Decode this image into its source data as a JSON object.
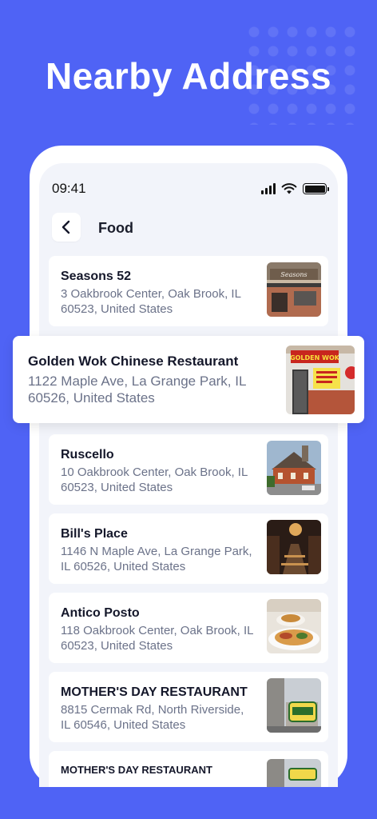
{
  "headline": "Nearby Address",
  "status": {
    "time": "09:41"
  },
  "nav": {
    "title": "Food"
  },
  "featured": {
    "name": "Golden Wok Chinese Restaurant",
    "address": "1122 Maple Ave, La Grange Park, IL 60526, United States"
  },
  "places": [
    {
      "name": "Seasons 52",
      "address": "3 Oakbrook Center, Oak Brook, IL 60523, United States"
    },
    {
      "name": "Ruscello",
      "address": "10 Oakbrook Center, Oak Brook, IL 60523, United States"
    },
    {
      "name": "Bill's Place",
      "address": "1146 N Maple Ave, La Grange Park, IL 60526, United States"
    },
    {
      "name": "Antico Posto",
      "address": "118 Oakbrook Center, Oak Brook, IL 60523, United States"
    },
    {
      "name": "MOTHER'S DAY RESTAURANT",
      "address": "8815 Cermak Rd, North Riverside, IL 60546, United States"
    },
    {
      "name": "MOTHER'S DAY RESTAURANT"
    }
  ],
  "colors": {
    "background": "#4f63f5",
    "card": "#ffffff",
    "screen": "#f2f4fa",
    "title": "#14172a",
    "address": "#6b7289"
  }
}
